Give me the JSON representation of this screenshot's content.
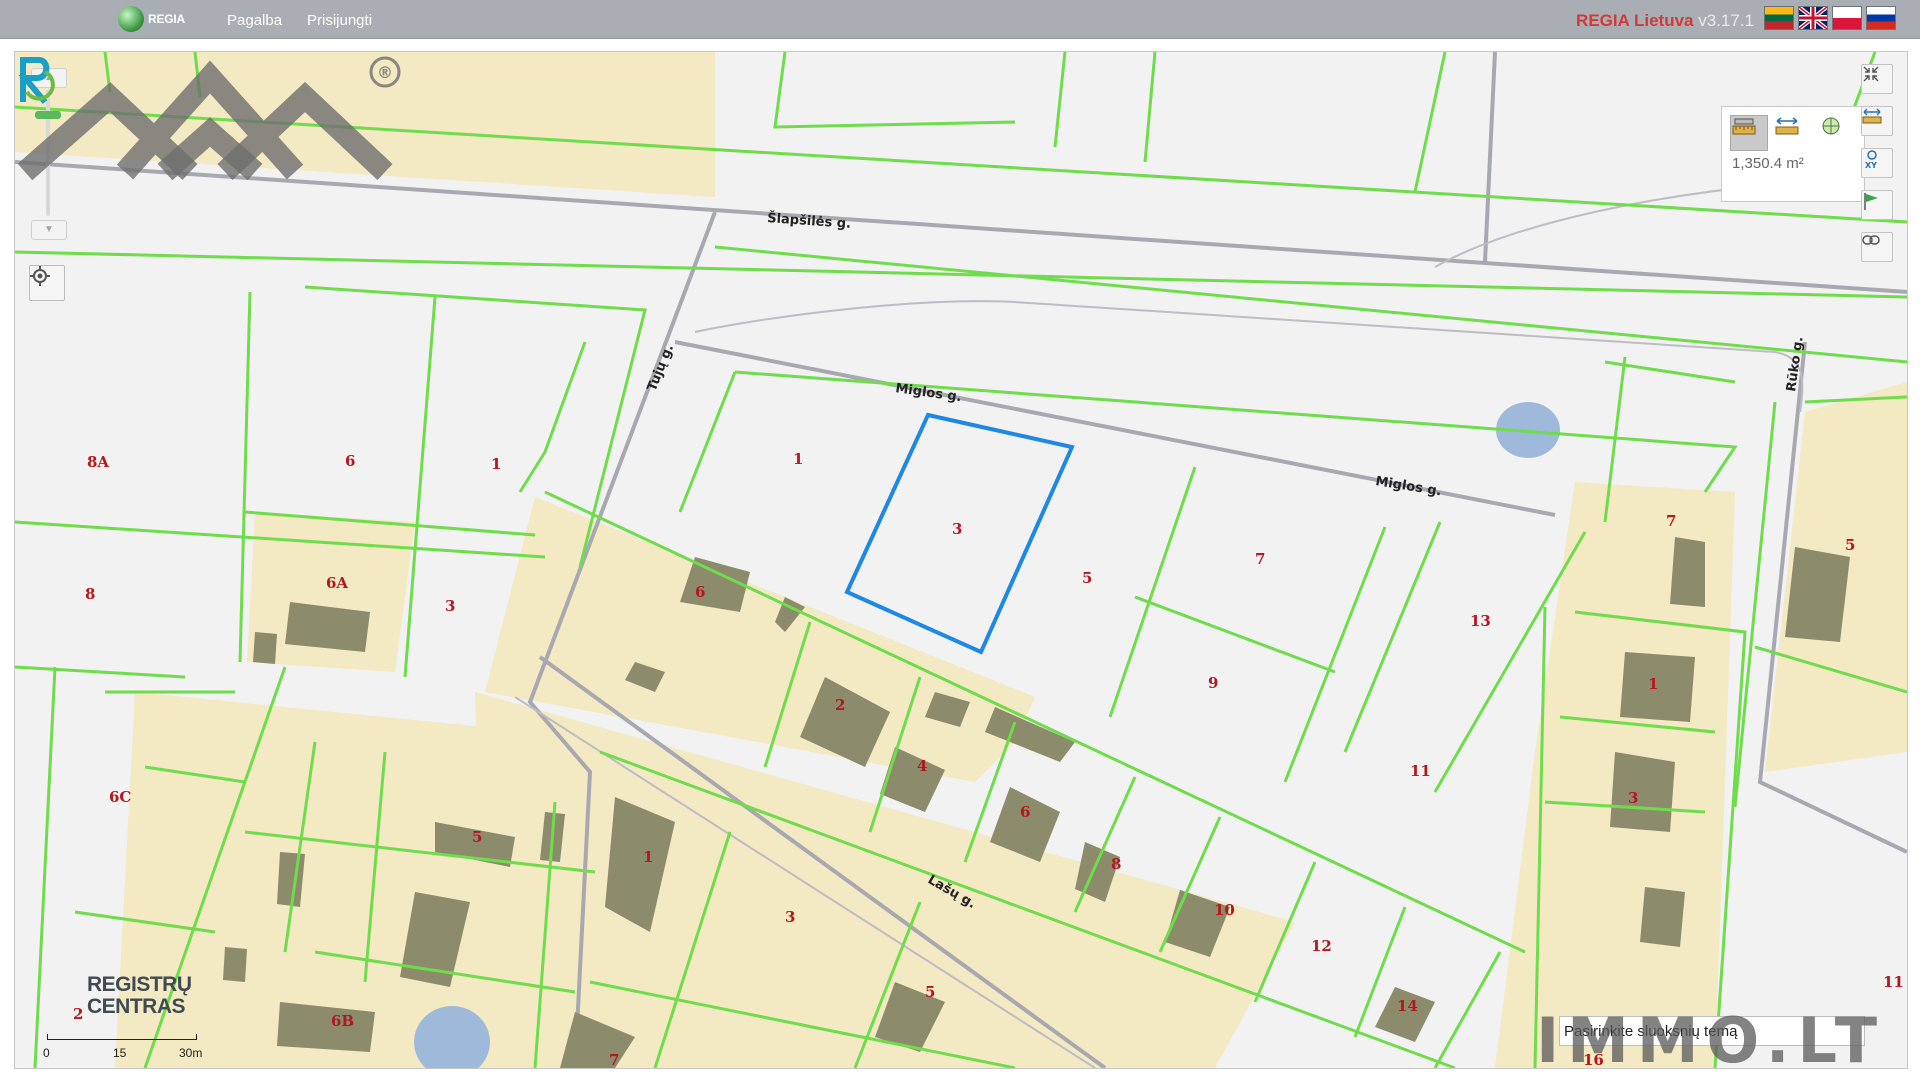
{
  "topbar": {
    "logo_text": "REGIA",
    "nav": [
      "Pagalba",
      "Prisijungti"
    ],
    "brand": "REGIA Lietuva",
    "version": "v3.17.1",
    "languages": [
      "lt",
      "en",
      "pl",
      "ru"
    ]
  },
  "map": {
    "streets": [
      "Šlapšilės g.",
      "Miglos g.",
      "Miglos g.",
      "Tujų g.",
      "Rūko g.",
      "Lašų g."
    ],
    "parcels": [
      "1",
      "3",
      "5",
      "7",
      "9",
      "11",
      "13",
      "6",
      "2",
      "4",
      "6",
      "8",
      "10",
      "12",
      "14",
      "8A",
      "6",
      "1",
      "6A",
      "3",
      "8",
      "6C",
      "5",
      "1",
      "3",
      "5",
      "7",
      "1",
      "3",
      "5",
      "2",
      "6B",
      "7",
      "16",
      "11"
    ],
    "selected_parcel": "3",
    "colors": {
      "parcel_border": "#6fdc4c",
      "built_area": "#f3e9c3",
      "building": "#8c8b6b",
      "selection": "#1e88e5",
      "road": "#a8a8b0",
      "water": "#9fb9db"
    }
  },
  "measure": {
    "value": "1,350.4 m²",
    "tabs": [
      "area-measure",
      "distance-measure",
      "coordinate-measure"
    ]
  },
  "tools": [
    "fullscreen",
    "measure",
    "xy-coordinates",
    "flag",
    "link"
  ],
  "zoom": {
    "in": "▲",
    "out": "▼",
    "level_fraction": 0.8
  },
  "bottom_left": {
    "org_line1": "REGISTRŲ",
    "org_line2": "CENTRAS",
    "scale_ticks": [
      "0",
      "15",
      "30m"
    ]
  },
  "bottom_right": {
    "layer_select": "Pasirinkite sluoksnių temą",
    "watermark": "IMMO.LT",
    "trademark": "®"
  }
}
